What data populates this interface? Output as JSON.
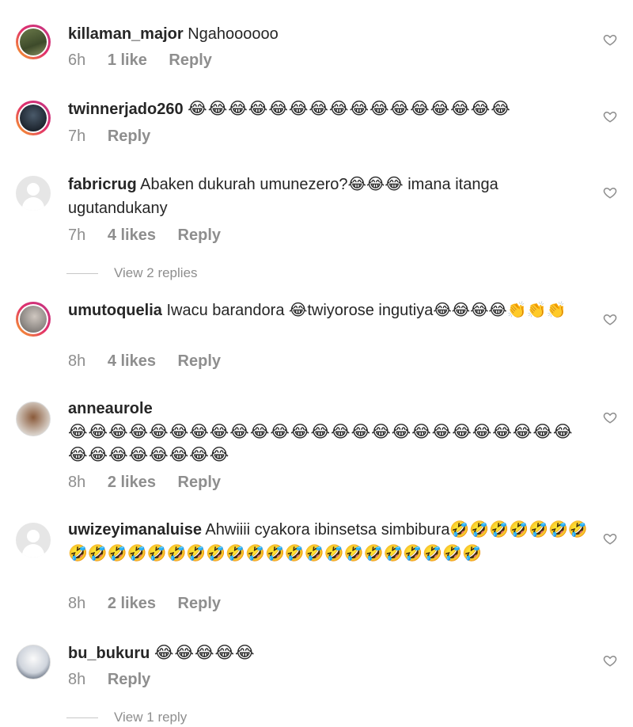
{
  "comments": [
    {
      "username": "killaman_major",
      "text": "Ngahoooooo",
      "time": "6h",
      "likes": "1 like",
      "reply": "Reply"
    },
    {
      "username": "twinnerjado260",
      "text": "😂😂😂😂😂😂😂😂😂😂😂😂😂😂😂😂",
      "time": "7h",
      "likes": "",
      "reply": "Reply"
    },
    {
      "username": "fabricrug",
      "text": "Abaken dukurah umunezero?😂😂😂 imana itanga ugutandukany",
      "time": "7h",
      "likes": "4 likes",
      "reply": "Reply",
      "view_replies": "View 2 replies"
    },
    {
      "username": "umutoquelia",
      "text": "Iwacu barandora 😂twiyorose ingutiya😂😂😂😂👏👏👏",
      "time": "8h",
      "likes": "4 likes",
      "reply": "Reply"
    },
    {
      "username": "anneaurole",
      "text": "😂😂😂😂😂😂😂😂😂😂😂😂😂😂😂😂😂😂😂😂😂😂😂😂😂😂😂😂😂😂😂😂😂",
      "time": "8h",
      "likes": "2 likes",
      "reply": "Reply"
    },
    {
      "username": "uwizeyimanaluise",
      "text": "Ahwiiii cyakora ibinsetsa simbibura🤣🤣🤣🤣🤣🤣🤣🤣🤣🤣🤣🤣🤣🤣🤣🤣🤣🤣🤣🤣🤣🤣🤣🤣🤣🤣🤣🤣",
      "time": "8h",
      "likes": "2 likes",
      "reply": "Reply"
    },
    {
      "username": "bu_bukuru",
      "text": "😂😂😂😂😂",
      "time": "8h",
      "likes": "",
      "reply": "Reply",
      "view_replies": "View 1 reply"
    }
  ]
}
